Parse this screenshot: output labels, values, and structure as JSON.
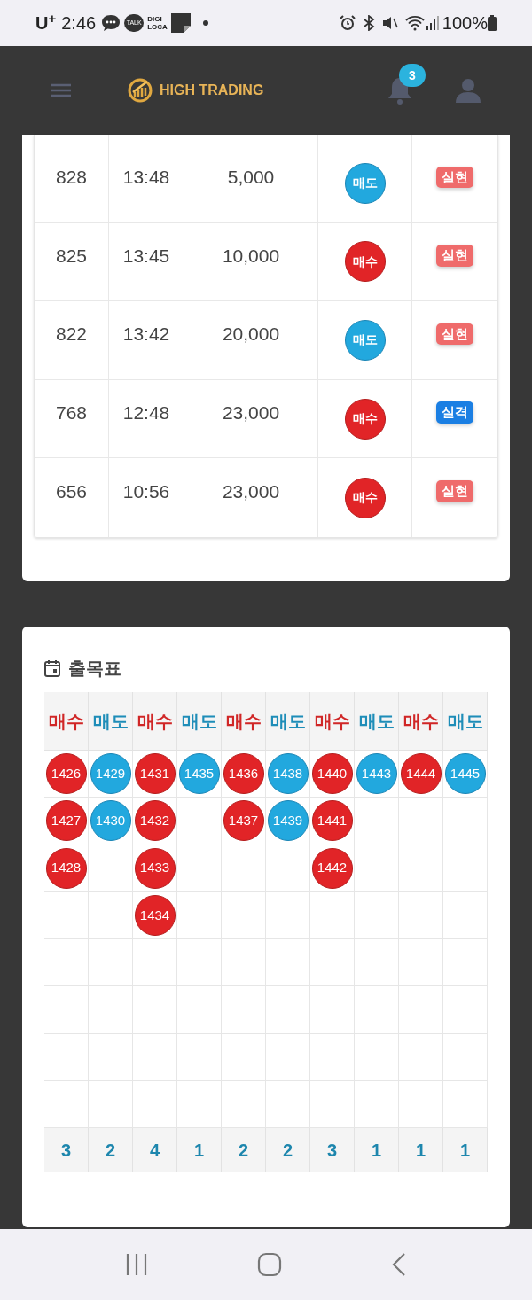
{
  "status_bar": {
    "carrier": "U$^{+}$",
    "time": "2:46",
    "talk_icon_text": "TALK",
    "digi_icon_text": [
      "DIGI",
      "LOCA"
    ],
    "battery": "100%"
  },
  "header": {
    "brand": "HIGH TRADING",
    "notification_count": "3"
  },
  "trades": [
    {
      "round": "828",
      "time": "13:48",
      "amount": "5,000",
      "side": {
        "kind": "sell",
        "label": "매도"
      },
      "result": {
        "kind": "realized",
        "label": "실현"
      }
    },
    {
      "round": "825",
      "time": "13:45",
      "amount": "10,000",
      "side": {
        "kind": "buy",
        "label": "매수"
      },
      "result": {
        "kind": "realized",
        "label": "실현"
      }
    },
    {
      "round": "822",
      "time": "13:42",
      "amount": "20,000",
      "side": {
        "kind": "sell",
        "label": "매도"
      },
      "result": {
        "kind": "realized",
        "label": "실현"
      }
    },
    {
      "round": "768",
      "time": "12:48",
      "amount": "23,000",
      "side": {
        "kind": "buy",
        "label": "매수"
      },
      "result": {
        "kind": "disqualified",
        "label": "실격"
      }
    },
    {
      "round": "656",
      "time": "10:56",
      "amount": "23,000",
      "side": {
        "kind": "buy",
        "label": "매수"
      },
      "result": {
        "kind": "realized",
        "label": "실현"
      }
    }
  ],
  "chart": {
    "title": "출목표",
    "columns": [
      {
        "kind": "buy",
        "label": "매수",
        "entries": [
          "1426",
          "1427",
          "1428"
        ],
        "count": "3"
      },
      {
        "kind": "sell",
        "label": "매도",
        "entries": [
          "1429",
          "1430"
        ],
        "count": "2"
      },
      {
        "kind": "buy",
        "label": "매수",
        "entries": [
          "1431",
          "1432",
          "1433",
          "1434"
        ],
        "count": "4"
      },
      {
        "kind": "sell",
        "label": "매도",
        "entries": [
          "1435"
        ],
        "count": "1"
      },
      {
        "kind": "buy",
        "label": "매수",
        "entries": [
          "1436",
          "1437"
        ],
        "count": "2"
      },
      {
        "kind": "sell",
        "label": "매도",
        "entries": [
          "1438",
          "1439"
        ],
        "count": "2"
      },
      {
        "kind": "buy",
        "label": "매수",
        "entries": [
          "1440",
          "1441",
          "1442"
        ],
        "count": "3"
      },
      {
        "kind": "sell",
        "label": "매도",
        "entries": [
          "1443"
        ],
        "count": "1"
      },
      {
        "kind": "buy",
        "label": "매수",
        "entries": [
          "1444"
        ],
        "count": "1"
      },
      {
        "kind": "sell",
        "label": "매도",
        "entries": [
          "1445"
        ],
        "count": "1"
      }
    ]
  }
}
